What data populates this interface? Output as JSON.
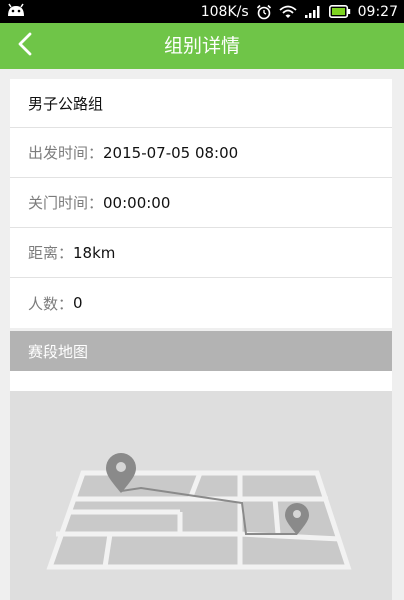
{
  "status_bar": {
    "speed": "108K/s",
    "time": "09:27"
  },
  "header": {
    "title": "组别详情"
  },
  "details": {
    "group_name": "男子公路组",
    "departure_label": "出发时间：",
    "departure_value": "2015-07-05 08:00",
    "close_label": "关门时间：",
    "close_value": "00:00:00",
    "distance_label": "距离：",
    "distance_value": "18km",
    "count_label": "人数：",
    "count_value": "0"
  },
  "map_section": {
    "title": "赛段地图"
  },
  "icons": {
    "back": "chevron-left-icon",
    "android": "android-icon",
    "alarm": "alarm-icon",
    "wifi": "wifi-icon",
    "signal": "signal-icon",
    "battery": "battery-icon",
    "pin": "map-pin-icon"
  },
  "colors": {
    "accent": "#6fc548",
    "section_header": "#b3b3b3",
    "map_background": "#dedede",
    "pin": "#8a8a8a"
  }
}
